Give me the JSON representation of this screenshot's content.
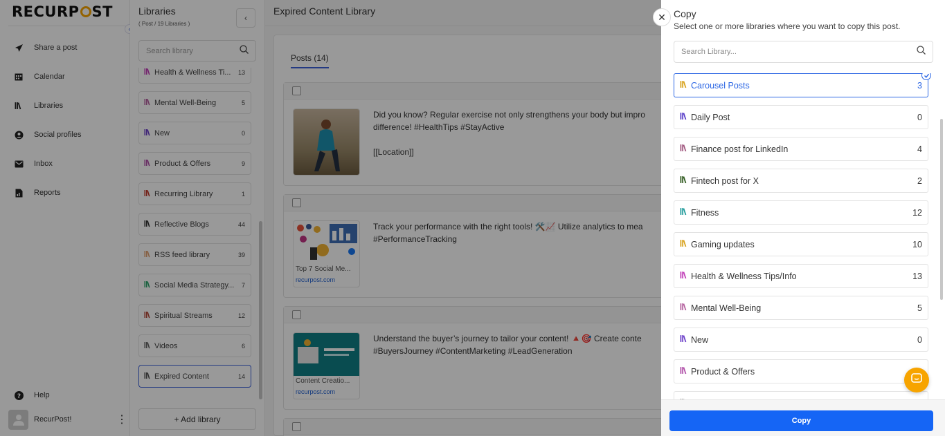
{
  "sidebar": {
    "logo": "RECURPOST",
    "nav": [
      {
        "label": "Share a post",
        "icon": "send-icon"
      },
      {
        "label": "Calendar",
        "icon": "calendar-icon"
      },
      {
        "label": "Libraries",
        "icon": "library-icon"
      },
      {
        "label": "Social profiles",
        "icon": "profile-icon"
      },
      {
        "label": "Inbox",
        "icon": "inbox-icon"
      },
      {
        "label": "Reports",
        "icon": "report-icon"
      }
    ],
    "help_label": "Help",
    "user_name": "RecurPost!"
  },
  "libraries_panel": {
    "title": "Libraries",
    "subtitle": "( Post / 19 Libraries )",
    "search_placeholder": "Search library",
    "items": [
      {
        "name": "Health & Wellness Ti...",
        "count": "13",
        "color": "#c13fb8"
      },
      {
        "name": "Mental Well-Being",
        "count": "5",
        "color": "#b4609e"
      },
      {
        "name": "New",
        "count": "0",
        "color": "#6b3fc8"
      },
      {
        "name": "Product & Offers",
        "count": "9",
        "color": "#b04fa8"
      },
      {
        "name": "Recurring Library",
        "count": "1",
        "color": "#c0392b"
      },
      {
        "name": "Reflective Blogs",
        "count": "44",
        "color": "#333333"
      },
      {
        "name": "RSS feed library",
        "count": "39",
        "color": "#e0a070"
      },
      {
        "name": "Social Media Strategy...",
        "count": "7",
        "color": "#2ea36b"
      },
      {
        "name": "Spiritual Streams",
        "count": "12",
        "color": "#b54a3a"
      },
      {
        "name": "Videos",
        "count": "6",
        "color": "#666666"
      },
      {
        "name": "Expired Content",
        "count": "14",
        "color": "#555555"
      }
    ],
    "add_label": "+ Add library"
  },
  "main": {
    "title": "Expired Content Library",
    "tab_label": "Posts (14)",
    "posts": [
      {
        "lines": [
          "Did you know? Regular exercise not only strengthens your body but impro",
          "difference! #HealthTips #StayActive",
          "",
          "[[Location]]"
        ],
        "caption": "",
        "link": ""
      },
      {
        "lines": [
          "Track your performance with the right tools! 🛠️📈 Utilize analytics to mea",
          "#PerformanceTracking"
        ],
        "caption": "Top 7 Social Me...",
        "link": "recurpost.com"
      },
      {
        "lines": [
          "Understand the buyer’s journey to tailor your content! 🔺🎯 Create conte",
          "#BuyersJourney #ContentMarketing #LeadGeneration"
        ],
        "caption": "Content Creatio...",
        "link": "recurpost.com"
      }
    ]
  },
  "copy_panel": {
    "title": "Copy",
    "subtitle": "Select one or more libraries where you want to copy this post.",
    "search_placeholder": "Search Library...",
    "button_label": "Copy",
    "items": [
      {
        "name": "Carousel Posts",
        "count": "3",
        "color": "#d8a21c",
        "selected": true
      },
      {
        "name": "Daily Post",
        "count": "0",
        "color": "#5a3fc8",
        "selected": false
      },
      {
        "name": "Finance post for LinkedIn",
        "count": "4",
        "color": "#a0567e",
        "selected": false
      },
      {
        "name": "Fintech post for X",
        "count": "2",
        "color": "#2f5a1e",
        "selected": false
      },
      {
        "name": "Fitness",
        "count": "12",
        "color": "#1f9a9a",
        "selected": false
      },
      {
        "name": "Gaming updates",
        "count": "10",
        "color": "#d8a21c",
        "selected": false
      },
      {
        "name": "Health & Wellness Tips/Info",
        "count": "13",
        "color": "#c13fb8",
        "selected": false
      },
      {
        "name": "Mental Well-Being",
        "count": "5",
        "color": "#b4609e",
        "selected": false
      },
      {
        "name": "New",
        "count": "0",
        "color": "#6b3fc8",
        "selected": false
      },
      {
        "name": "Product & Offers",
        "count": "",
        "color": "#b04fa8",
        "selected": false
      },
      {
        "name": "",
        "count": "",
        "color": "#999999",
        "selected": false
      }
    ]
  },
  "colors": {
    "accent": "#1565f5",
    "brand_orange": "#f7a400"
  }
}
